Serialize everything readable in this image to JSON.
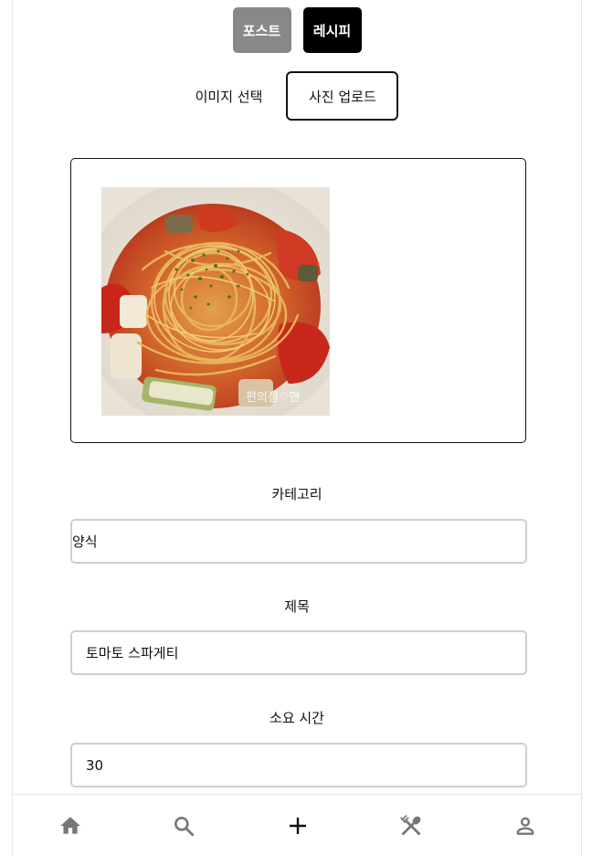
{
  "tabs": {
    "post": "포스트",
    "recipe": "레시피"
  },
  "upload": {
    "select_label": "이미지 선택",
    "button_label": "사진 업로드"
  },
  "form": {
    "category": {
      "label": "카테고리",
      "value": "양식"
    },
    "title": {
      "label": "제목",
      "value": "토마토 스파게티"
    },
    "time": {
      "label": "소요 시간",
      "value": "30"
    }
  },
  "photo": {
    "watermark": "편의점♡맨"
  },
  "nav": {
    "items": [
      {
        "icon": "home-icon"
      },
      {
        "icon": "search-icon"
      },
      {
        "icon": "plus-icon"
      },
      {
        "icon": "utensils-icon"
      },
      {
        "icon": "user-icon"
      }
    ]
  },
  "colors": {
    "post_tab": "#888888",
    "recipe_tab": "#000000",
    "icon_gray": "#777777",
    "field_border": "#cfcfcf"
  }
}
